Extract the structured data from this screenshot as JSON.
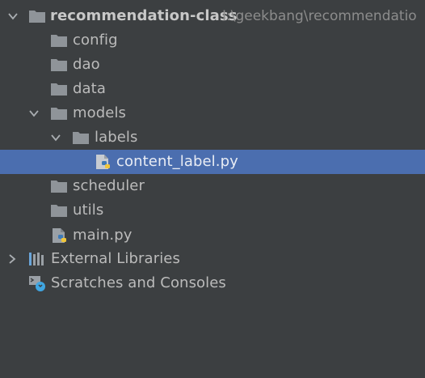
{
  "project_tree": {
    "root": {
      "name": "recommendation-class",
      "path": "I:\\geekbang\\recommendatio"
    },
    "items": [
      {
        "label": "config"
      },
      {
        "label": "dao"
      },
      {
        "label": "data"
      },
      {
        "label": "models"
      },
      {
        "label": "labels"
      },
      {
        "label": "content_label.py"
      },
      {
        "label": "scheduler"
      },
      {
        "label": "utils"
      },
      {
        "label": "main.py"
      },
      {
        "label": "External Libraries"
      },
      {
        "label": "Scratches and Consoles"
      }
    ]
  }
}
